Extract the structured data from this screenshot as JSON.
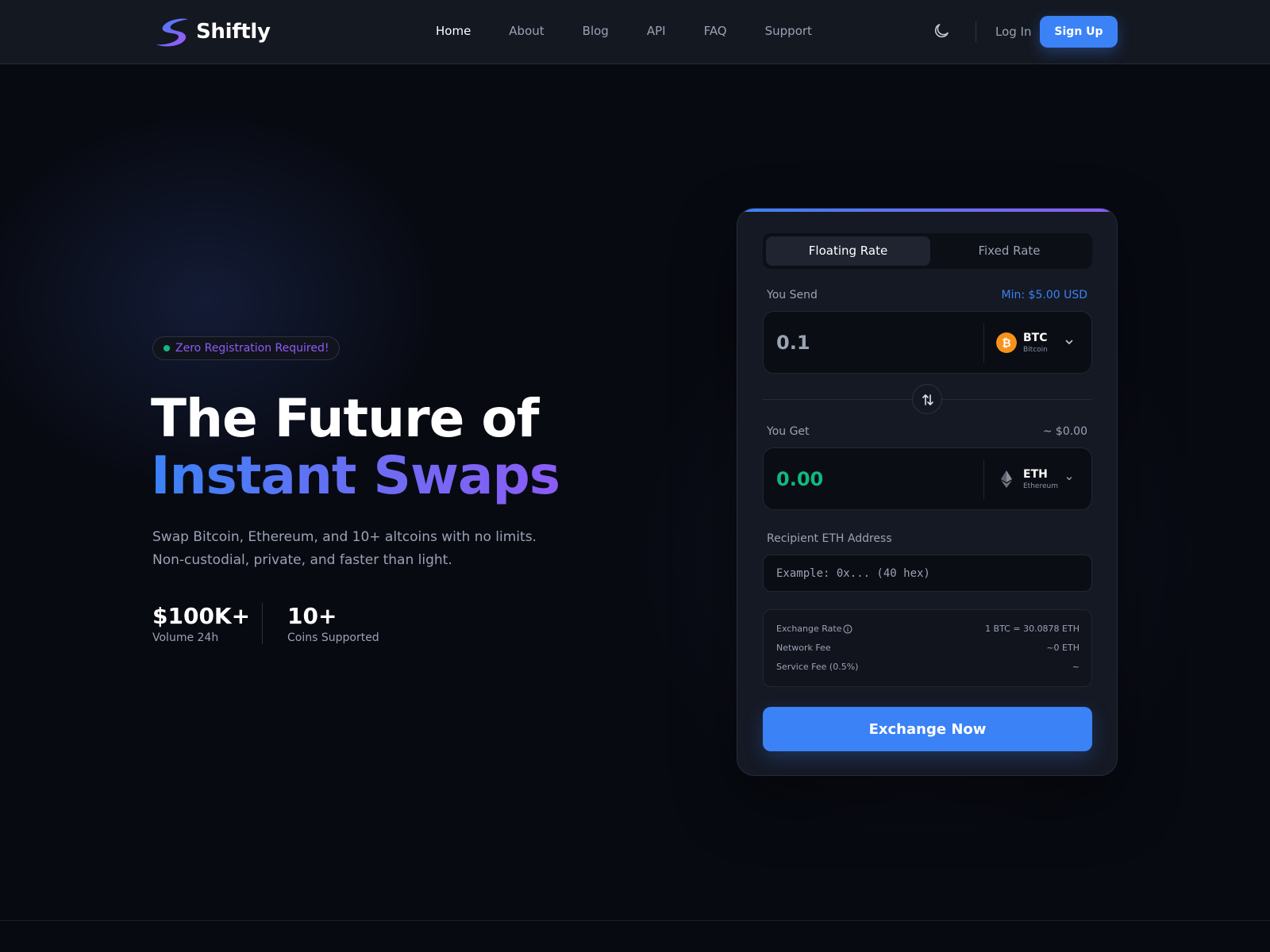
{
  "header": {
    "brand": "Shiftly",
    "nav": [
      "Home",
      "About",
      "Blog",
      "API",
      "FAQ",
      "Support"
    ],
    "active_nav": "Home",
    "login_label": "Log In",
    "signup_label": "Sign Up",
    "theme_icon": "moon-icon"
  },
  "hero": {
    "badge": "Zero Registration Required!",
    "title_line1": "The Future of",
    "title_line2": "Instant Swaps",
    "subtitle_line1": "Swap Bitcoin, Ethereum, and 10+ altcoins with no limits.",
    "subtitle_line2": "Non-custodial, private, and faster than light.",
    "stats": [
      {
        "value": "$100K+",
        "label": "Volume 24h"
      },
      {
        "value": "10+",
        "label": "Coins Supported"
      }
    ]
  },
  "exchange": {
    "tabs": [
      "Floating Rate",
      "Fixed Rate"
    ],
    "active_tab": "Floating Rate",
    "send": {
      "label": "You Send",
      "min": "Min: $5.00 USD",
      "amount": "0.1",
      "coin_ticker": "BTC",
      "coin_name": "Bitcoin",
      "coin_icon": "bitcoin-icon"
    },
    "get": {
      "label": "You Get",
      "usd_estimate": "~ $0.00",
      "amount": "0.00",
      "coin_ticker": "ETH",
      "coin_name": "Ethereum",
      "coin_icon": "ethereum-icon"
    },
    "recipient": {
      "label": "Recipient ETH Address",
      "placeholder": "Example: 0x... (40 hex)",
      "value": ""
    },
    "details": [
      {
        "key": "Exchange Rate",
        "value": "1 BTC = 30.0878 ETH"
      },
      {
        "key": "Network Fee",
        "value": "~0 ETH"
      },
      {
        "key": "Service Fee (0.5%)",
        "value": "~"
      }
    ],
    "cta_label": "Exchange Now"
  },
  "colors": {
    "background": "#080a12",
    "accent": "#3b82f6",
    "accent_purple": "#8b5cf6",
    "success": "#10b981",
    "bitcoin": "#f7931a"
  }
}
